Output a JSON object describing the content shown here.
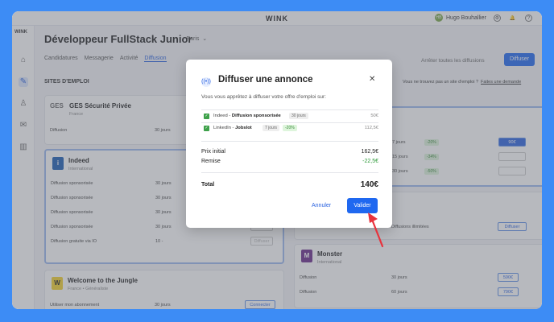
{
  "topbar": {
    "logo": "WINK",
    "user_initials": "HB",
    "user_name": "Hugo Bouhallier"
  },
  "sidebar": {
    "brand": "WINK",
    "icons": [
      "home-icon",
      "pencil-icon",
      "user-icon",
      "mail-icon",
      "chart-icon"
    ]
  },
  "page": {
    "title": "Développeur FullStack Junior",
    "location": "Paris",
    "tabs": [
      "Candidatures",
      "Messagerie",
      "Activité",
      "Diffusion"
    ],
    "stop_label": "Arrêter toutes les diffusions",
    "diffuser_label": "Diffuser",
    "section": "SITES D'EMPLOI",
    "not_found": "Vous ne trouvez pas un site d'emploi ?",
    "not_found_link": "Faites une demande"
  },
  "cards": {
    "ges": {
      "name": "GES Sécurité Privée",
      "sub": "France",
      "row1": "Diffusion",
      "row1_days": "30 jours"
    },
    "indeed": {
      "name": "Indeed",
      "sub": "International",
      "rows": [
        "Diffusion sponsorisée",
        "Diffusion sponsorisée",
        "Diffusion sponsorisée",
        "Diffusion sponsorisée",
        "Diffusion gratuite via IO"
      ],
      "days": [
        "30 jours",
        "30 jours",
        "30 jours",
        "30 jours",
        "10 -"
      ],
      "btn": "Diffuser"
    },
    "wttj": {
      "name": "Welcome to the Jungle",
      "sub": "France • Généraliste",
      "row": "Utiliser mon abonnement",
      "days": "30 jours",
      "btn": "Connecter"
    },
    "right_top": {
      "days": [
        "7 jours",
        "15 jours",
        "30 jours"
      ],
      "discounts": [
        "-20%",
        "-34%",
        "-50%"
      ],
      "btn1": "90€"
    },
    "right_mid": {
      "row": "Diffusions illimitées",
      "btn": "Diffuser"
    },
    "monster": {
      "name": "Monster",
      "sub": "International",
      "rows": [
        "Diffusion",
        "Diffusion"
      ],
      "days": [
        "30 jours",
        "60 jours"
      ],
      "prices": [
        "590€",
        "790€"
      ]
    }
  },
  "modal": {
    "title": "Diffuser une annonce",
    "subtitle": "Vous vous apprêtez à diffuser votre offre d'emploi sur:",
    "items": [
      {
        "site": "Indeed",
        "product": "Diffusion sponsorisée",
        "days": "30 jours",
        "discount": "",
        "price": "50€"
      },
      {
        "site": "LinkedIn",
        "product": "Jobslot",
        "days": "7 jours",
        "discount": "-20%",
        "price": "112,5€"
      }
    ],
    "prix_initial_label": "Prix initial",
    "prix_initial": "162,5€",
    "remise_label": "Remise",
    "remise": "-22,5€",
    "total_label": "Total",
    "total": "140€",
    "cancel": "Annuler",
    "confirm": "Valider"
  },
  "colors": {
    "accent": "#1f68f0",
    "background": "#3d8cf5",
    "success": "#2e9a3a",
    "annotation": "#e8323c"
  }
}
